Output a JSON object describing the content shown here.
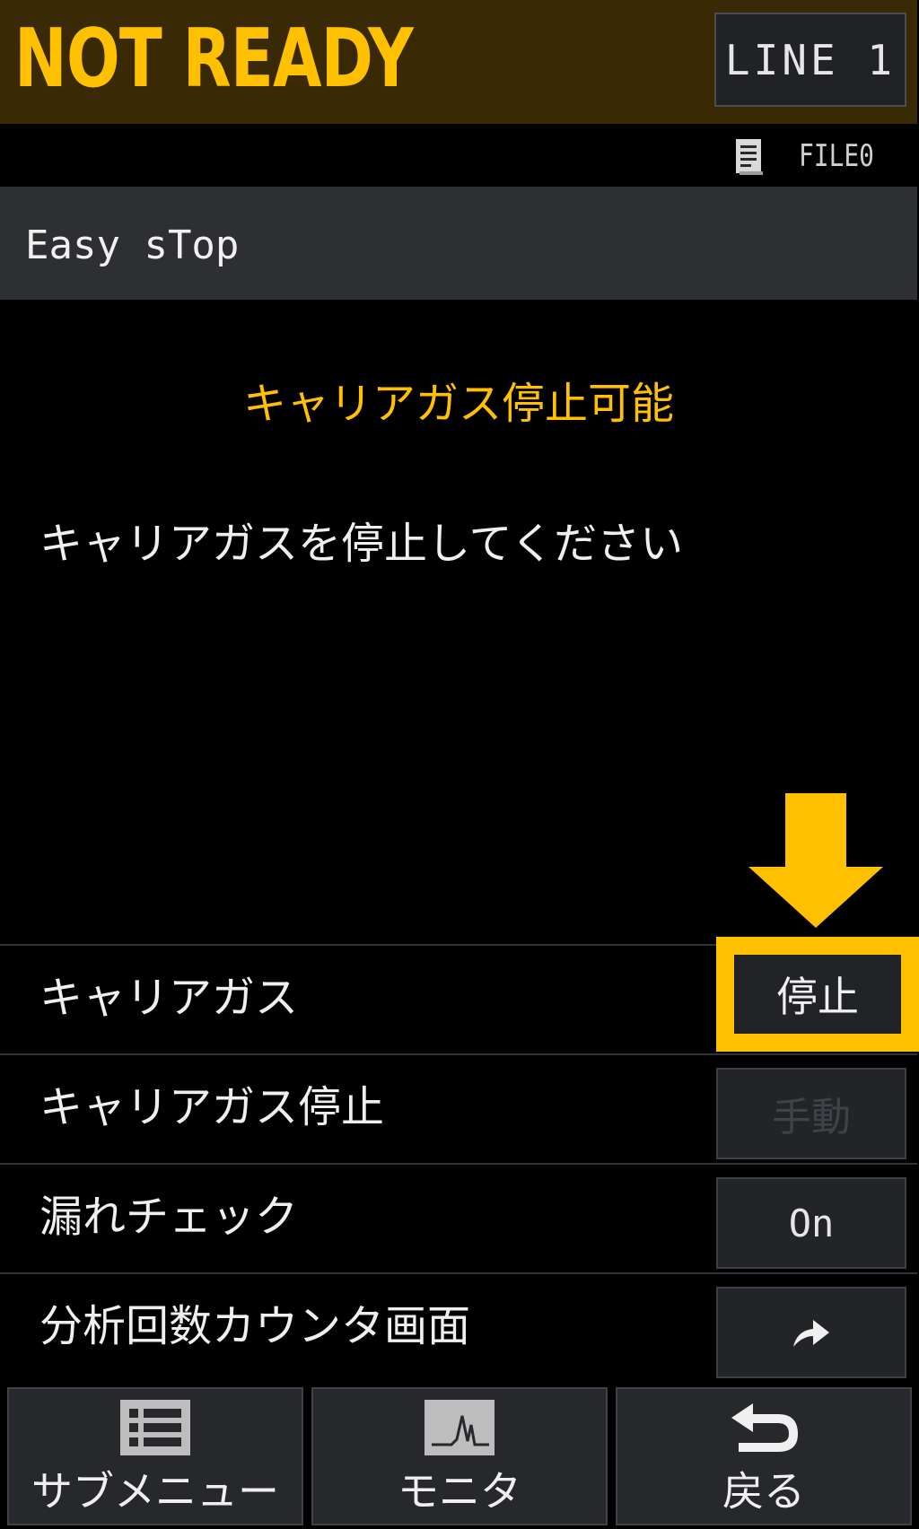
{
  "header": {
    "status": "NOT READY",
    "line_button": "LINE 1"
  },
  "file": {
    "icon": "file-icon",
    "label": "FILE0"
  },
  "screen": {
    "title": "Easy sTop"
  },
  "message": {
    "heading": "キャリアガス停止可能",
    "body": "キャリアガスを停止してください"
  },
  "settings": {
    "rows": [
      {
        "label": "キャリアガス",
        "button": "停止",
        "state": "active"
      },
      {
        "label": "キャリアガス停止",
        "button": "手動",
        "state": "disabled"
      },
      {
        "label": "漏れチェック",
        "button": "On",
        "state": "active"
      },
      {
        "label": "分析回数カウンタ画面",
        "button_icon": "go-arrow-icon",
        "state": "active"
      }
    ]
  },
  "bottom_nav": {
    "items": [
      {
        "label": "サブメニュー",
        "icon": "list-icon"
      },
      {
        "label": "モニタ",
        "icon": "monitor-chart-icon"
      },
      {
        "label": "戻る",
        "icon": "back-arrow-icon"
      }
    ]
  },
  "colors": {
    "accent": "#ffc000",
    "header_bg": "#392904",
    "button_bg": "#222428",
    "disabled_text": "#3f4246"
  }
}
